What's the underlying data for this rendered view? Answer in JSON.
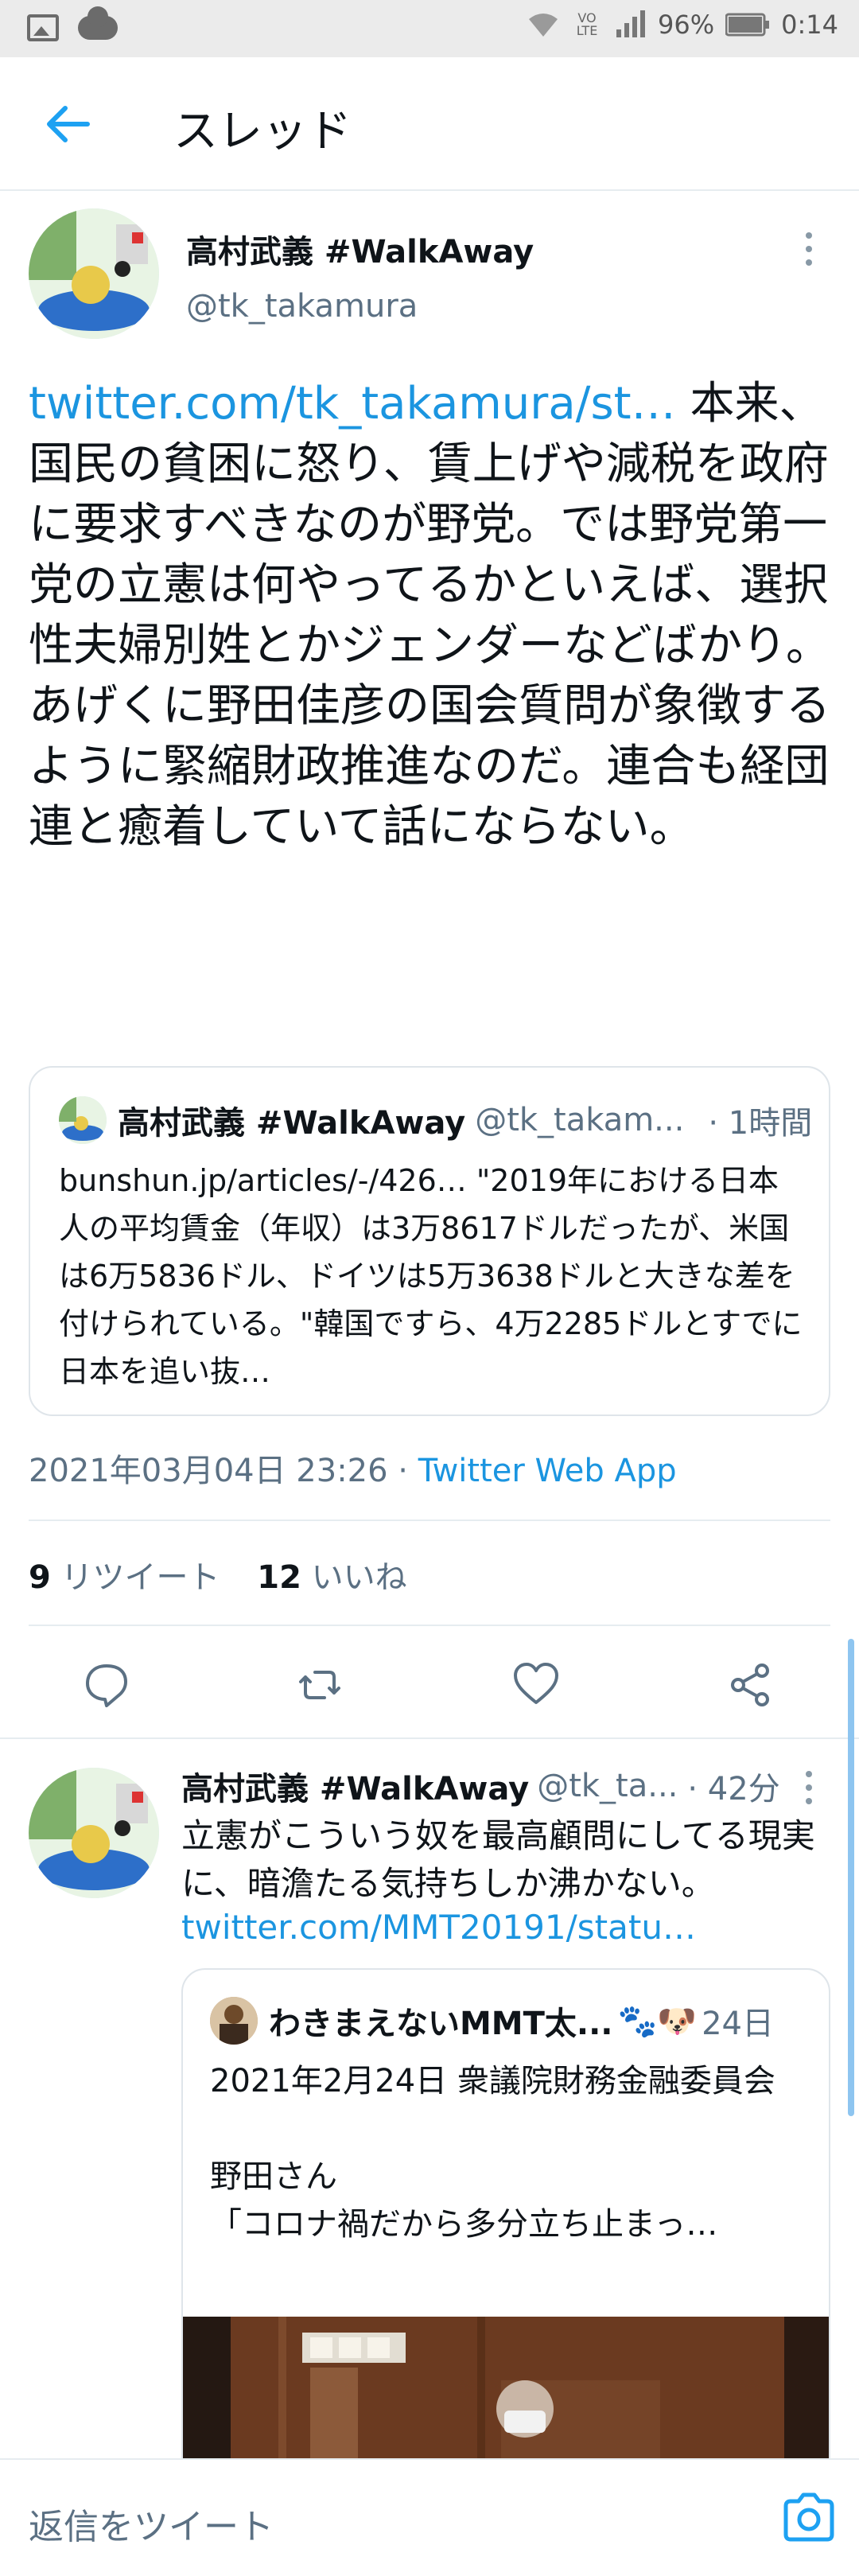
{
  "status_bar": {
    "battery": "96%",
    "time": "0:14",
    "volte": "VO LTE"
  },
  "header": {
    "title": "スレッド"
  },
  "main_tweet": {
    "name": "高村武義 #WalkAway",
    "handle": "@tk_takamura",
    "link_text": "twitter.com/tk_takamura/st…",
    "text": " 本来、国民の貧困に怒り、賃上げや減税を政府に要求すべきなのが野党。では野党第一党の立憲は何やってるかといえば、選択性夫婦別姓とかジェンダーなどばかり。あげくに野田佳彦の国会質問が象徴するように緊縮財政推進なのだ。連合も経団連と癒着していて話にならない。",
    "quote": {
      "name": "高村武義 #WalkAway",
      "handle": "@tk_takam...",
      "time": "· 1時間",
      "link": "bunshun.jp/articles/-/426…",
      "text": " \"2019年における日本人の平均賃金（年収）は3万8617ドルだったが、米国は6万5836ドル、ドイツは5万3638ドルと大きな差を付けられている。\"韓国ですら、4万2285ドルとすでに日本を追い抜…"
    },
    "date": "2021年03月04日 23:26",
    "source": "Twitter Web App",
    "retweets_count": "9",
    "retweets_label": "リツイート",
    "likes_count": "12",
    "likes_label": "いいね"
  },
  "reply_tweet": {
    "name": "高村武義 #WalkAway",
    "handle": "@tk_ta...",
    "time": "· 42分",
    "text": "立憲がこういう奴を最高顧問にしてる現実に、暗澹たる気持ちしか沸かない。",
    "link": "twitter.com/MMT20191/statu…",
    "quote": {
      "name": "わきまえないMMT太...",
      "emoji": "🐾🐶",
      "time": "24日",
      "text_line1": "2021年2月24日 衆議院財務金融委員会",
      "text_line2": "野田さん",
      "text_line3": "「コロナ禍だから多分立ち止まっ…"
    }
  },
  "reply_bar": {
    "placeholder": "返信をツイート"
  },
  "colors": {
    "link": "#1b95e0",
    "muted": "#5b7083",
    "accent": "#1da1f2"
  }
}
